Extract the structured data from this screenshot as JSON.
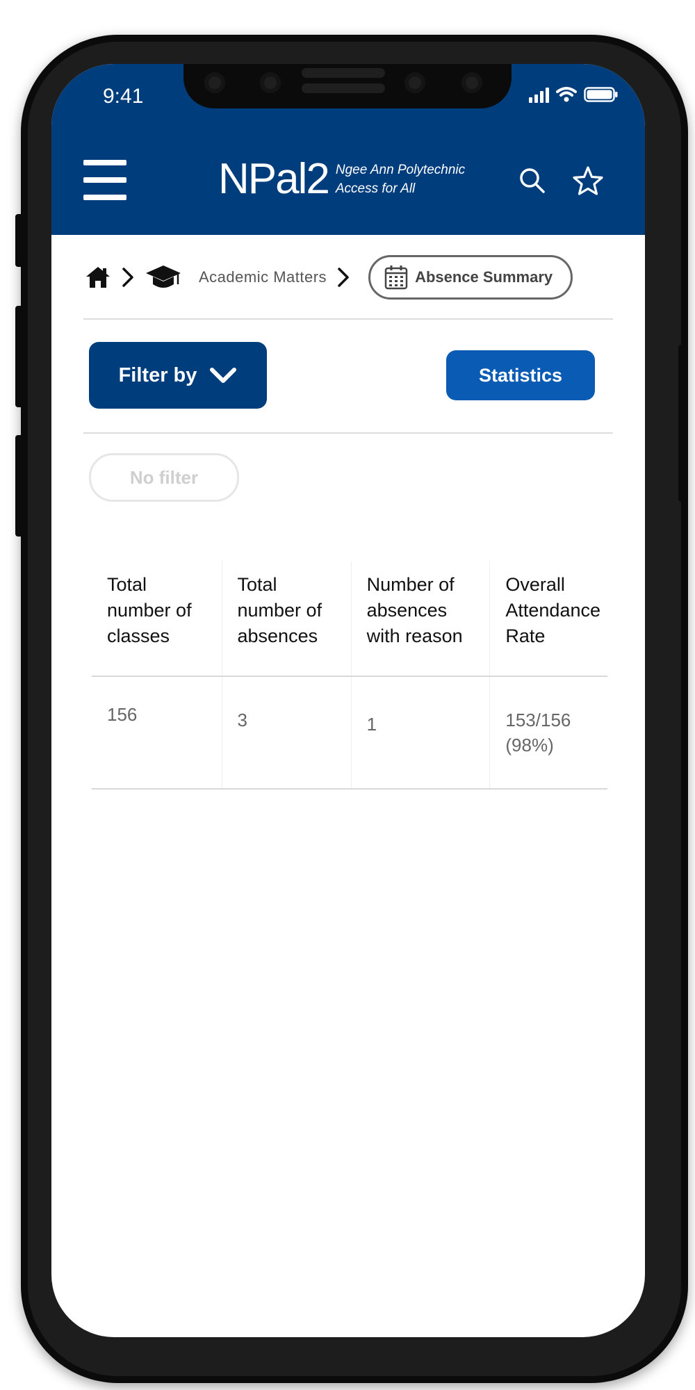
{
  "status_bar": {
    "time": "9:41",
    "icons": [
      "signal-icon",
      "wifi-icon",
      "battery-icon"
    ]
  },
  "header": {
    "logo_text": "NPal2",
    "tagline_line1": "Ngee Ann Polytechnic",
    "tagline_line2": "Access for All",
    "icons": [
      "menu-icon",
      "search-icon",
      "star-icon"
    ],
    "background_color": "#003d7c"
  },
  "breadcrumb": {
    "items": [
      {
        "icon": "home-icon"
      },
      {
        "icon": "graduation-cap-icon",
        "label": "Academic Matters"
      },
      {
        "icon": "calendar-icon",
        "label": "Absence Summary",
        "current": true
      }
    ]
  },
  "actions": {
    "filter_label": "Filter by",
    "statistics_label": "Statistics",
    "no_filter_label": "No filter",
    "filter_color": "#003d7c",
    "statistics_color": "#0a5bb3"
  },
  "table": {
    "headers": [
      [
        "Total",
        "number of",
        "classes"
      ],
      [
        "Total",
        "number of",
        "absences"
      ],
      [
        "Number of",
        "absences",
        "with reason"
      ],
      [
        "Overall",
        "Attendance",
        "Rate"
      ]
    ],
    "rows": [
      [
        "156",
        "3",
        "1",
        [
          "153/156",
          "(98%)"
        ]
      ]
    ]
  }
}
